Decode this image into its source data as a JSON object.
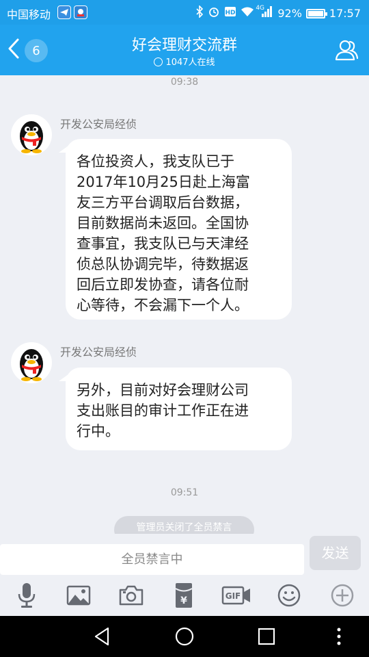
{
  "status_bar": {
    "carrier": "中国移动",
    "network_type": "4G",
    "battery": "92%",
    "battery_level": 0.92,
    "time": "17:57"
  },
  "header": {
    "back_badge": "6",
    "title": "好会理财交流群",
    "online_count": "1047人在线"
  },
  "messages": [
    {
      "type": "time",
      "text": "09:38"
    },
    {
      "type": "message",
      "sender": "开发公安局经侦",
      "lines": [
        "各位投资人，我支队已于",
        "2017年10月25日赴上海富",
        "友三方平台调取后台数据，",
        "目前数据尚未返回。全国协",
        "查事宜，我支队已与天津经",
        "侦总队协调完毕，待数据返",
        "回后立即发协查，请各位耐",
        "心等待，不会漏下一个人。"
      ]
    },
    {
      "type": "message",
      "sender": "开发公安局经侦",
      "lines": [
        "另外，目前对好会理财公司",
        "支出账目的审计工作正在进",
        "行中。"
      ]
    },
    {
      "type": "time",
      "text": "09:51"
    },
    {
      "type": "system",
      "text": "管理员关闭了全员禁言"
    }
  ],
  "input_bar": {
    "placeholder": "全员禁言中",
    "send_label": "发送"
  },
  "toolbar_icons": [
    "microphone-icon",
    "image-icon",
    "camera-icon",
    "red-packet-icon",
    "gif-icon",
    "emoji-icon",
    "plus-icon"
  ],
  "nav_icons": [
    "back-triangle-icon",
    "home-circle-icon",
    "recents-square-icon",
    "more-dots-icon"
  ],
  "colors": {
    "header_blue": "#21a3ee",
    "status_blue": "#1f9fe9",
    "chat_background": "#eef0f5",
    "bubble": "#ffffff",
    "icon_gray": "#666a72"
  }
}
